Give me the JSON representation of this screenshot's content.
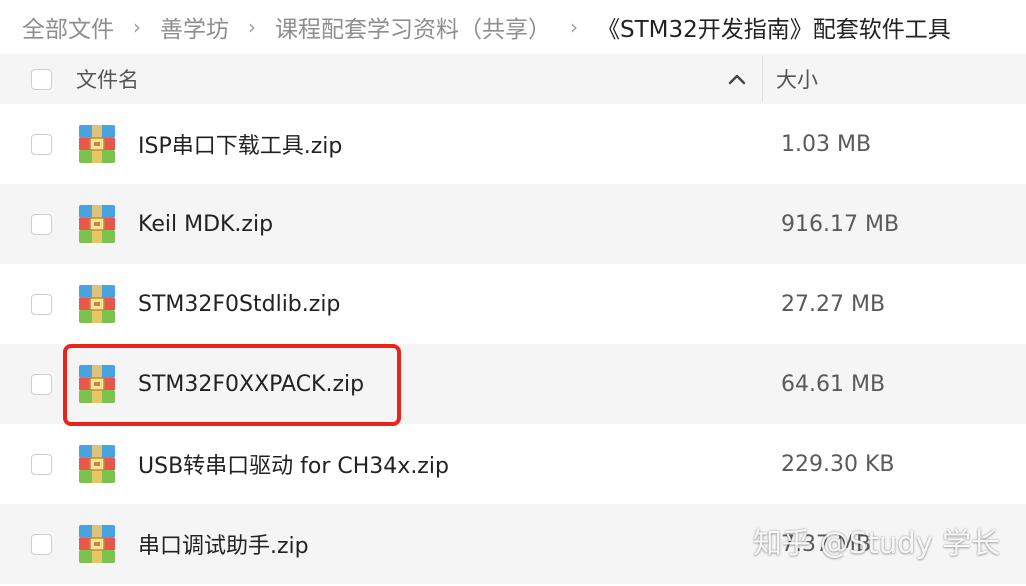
{
  "breadcrumb": {
    "items": [
      "全部文件",
      "善学坊",
      "课程配套学习资料（共享）",
      "《STM32开发指南》配套软件工具"
    ],
    "separator": "›"
  },
  "table": {
    "header": {
      "name_label": "文件名",
      "size_label": "大小",
      "sort": "ascending"
    },
    "files": [
      {
        "name": "ISP串口下载工具.zip",
        "size": "1.03 MB"
      },
      {
        "name": "Keil MDK.zip",
        "size": "916.17 MB"
      },
      {
        "name": "STM32F0Stdlib.zip",
        "size": "27.27 MB"
      },
      {
        "name": "STM32F0XXPACK.zip",
        "size": "64.61 MB",
        "highlighted": true
      },
      {
        "name": "USB转串口驱动 for CH34x.zip",
        "size": "229.30 KB"
      },
      {
        "name": "串口调试助手.zip",
        "size": "7.37 MB"
      }
    ]
  },
  "watermark": "知乎 @Study 学长",
  "icons": {
    "file_type": "zip-archive-icon",
    "sort": "chevron-up-icon"
  },
  "colors": {
    "highlight": "#e8241c",
    "row_alt": "#f5f5f5",
    "zip_blue": "#4aa3df",
    "zip_red": "#e8574a",
    "zip_green": "#7cc24e",
    "zip_tag": "#f4c96a"
  }
}
